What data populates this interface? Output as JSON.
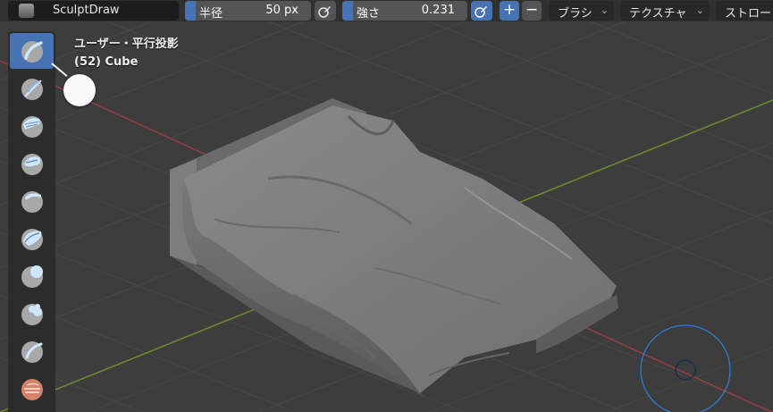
{
  "header": {
    "brush_name": "SculptDraw",
    "radius": {
      "label": "半径",
      "value": "50 px"
    },
    "strength": {
      "label": "強さ",
      "value": "0.231",
      "fraction": 0.231
    },
    "add_symbol": "+",
    "subtract_symbol": "−",
    "brush_menu": "ブラシ",
    "texture_menu": "テクスチャ",
    "stroke_menu": "ストロー"
  },
  "viewport": {
    "view_name": "ユーザー・平行投影",
    "object_info": "(52) Cube"
  },
  "tools": [
    {
      "name": "draw-brush-icon",
      "active": true
    },
    {
      "name": "draw-sharp-brush-icon",
      "active": false
    },
    {
      "name": "clay-brush-icon",
      "active": false
    },
    {
      "name": "clay-strips-brush-icon",
      "active": false
    },
    {
      "name": "layer-brush-icon",
      "active": false
    },
    {
      "name": "inflate-brush-icon",
      "active": false
    },
    {
      "name": "blob-brush-icon",
      "active": false
    },
    {
      "name": "crease-brush-icon",
      "active": false
    },
    {
      "name": "smooth-brush-icon",
      "active": false
    },
    {
      "name": "flatten-brush-icon",
      "active": false
    }
  ],
  "colors": {
    "accent": "#4772b3",
    "x_axis": "#9a3b44",
    "y_axis": "#6b8f2e",
    "brush_cursor": "#2f7fd6"
  }
}
